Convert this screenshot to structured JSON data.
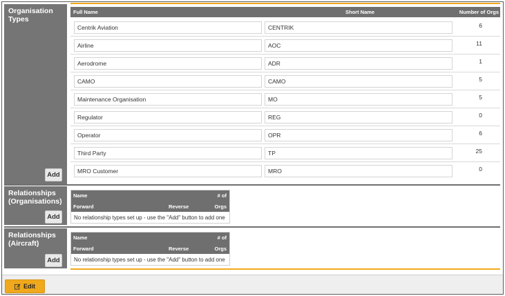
{
  "org_types": {
    "title": "Organisation Types",
    "add_label": "Add",
    "columns": {
      "full_name": "Full Name",
      "short_name": "Short Name",
      "count": "Number of Orgs"
    },
    "rows": [
      {
        "full": "Centrik Aviation",
        "short": "CENTRIK",
        "count": "6"
      },
      {
        "full": "Airline",
        "short": "AOC",
        "count": "11"
      },
      {
        "full": "Aerodrome",
        "short": "ADR",
        "count": "1"
      },
      {
        "full": "CAMO",
        "short": "CAMO",
        "count": "5"
      },
      {
        "full": "Maintenance Organisation",
        "short": "MO",
        "count": "5"
      },
      {
        "full": "Regulator",
        "short": "REG",
        "count": "0"
      },
      {
        "full": "Operator",
        "short": "OPR",
        "count": "6"
      },
      {
        "full": "Third Party",
        "short": "TP",
        "count": "25"
      },
      {
        "full": "MRO Customer",
        "short": "MRO",
        "count": "0"
      }
    ]
  },
  "rel_orgs": {
    "title": "Relationships (Organisations)",
    "add_label": "Add",
    "head": {
      "name": "Name",
      "count_top": "# of",
      "forward": "Forward",
      "reverse": "Reverse",
      "count_bottom": "Orgs"
    },
    "empty_text": "No relationship types set up - use the \"Add\" button to add one"
  },
  "rel_aircraft": {
    "title": "Relationships (Aircraft)",
    "add_label": "Add",
    "head": {
      "name": "Name",
      "count_top": "# of",
      "forward": "Forward",
      "reverse": "Reverse",
      "count_bottom": "Orgs"
    },
    "empty_text": "No relationship types set up - use the \"Add\" button to add one"
  },
  "footer": {
    "edit_label": "Edit"
  },
  "colors": {
    "accent": "#f0a81c",
    "label_bg": "#757575",
    "header_bg": "#6f6f6f"
  }
}
